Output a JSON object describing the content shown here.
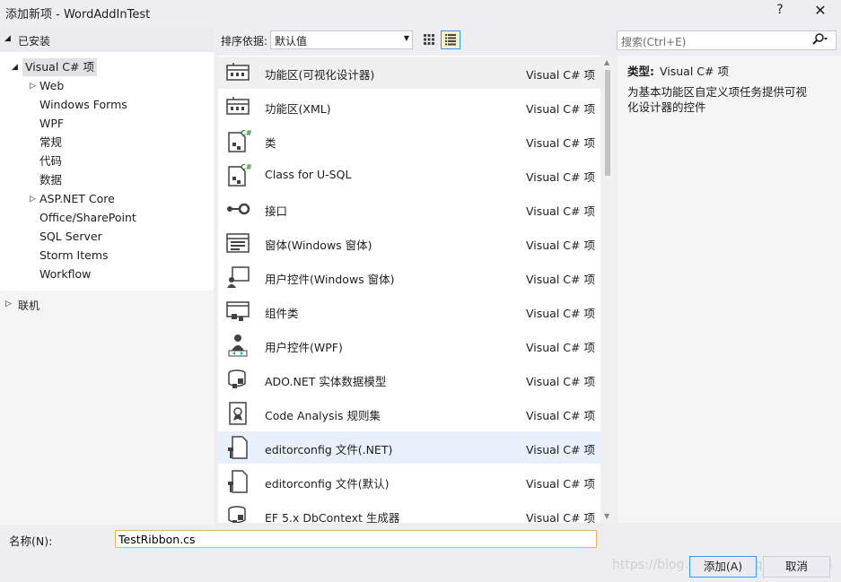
{
  "window": {
    "title": "添加新项 - WordAddInTest",
    "help_label": "?",
    "close_label": "✕"
  },
  "left_pane": {
    "installed_label": "已安装",
    "tree": [
      {
        "label": "Visual C# 项",
        "expand": "◢"
      },
      {
        "label": "Web",
        "expand": "▷"
      },
      {
        "label": "Windows Forms",
        "expand": ""
      },
      {
        "label": "WPF",
        "expand": ""
      },
      {
        "label": "常规",
        "expand": ""
      },
      {
        "label": "代码",
        "expand": ""
      },
      {
        "label": "数据",
        "expand": ""
      },
      {
        "label": "ASP.NET Core",
        "expand": "▷"
      },
      {
        "label": "Office/SharePoint",
        "expand": ""
      },
      {
        "label": "SQL Server",
        "expand": ""
      },
      {
        "label": "Storm Items",
        "expand": ""
      },
      {
        "label": "Workflow",
        "expand": ""
      }
    ],
    "online_label": "联机"
  },
  "toolbar": {
    "sort_label": "排序依据:",
    "sort_value": "默认值",
    "search_placeholder": "搜索(Ctrl+E)"
  },
  "items": [
    {
      "name": "功能区(可视化设计器)",
      "type": "Visual C# 项",
      "icon": "ribbon-icon"
    },
    {
      "name": "功能区(XML)",
      "type": "Visual C# 项",
      "icon": "ribbon-icon"
    },
    {
      "name": "类",
      "type": "Visual C# 项",
      "icon": "class-icon"
    },
    {
      "name": "Class for U-SQL",
      "type": "Visual C# 项",
      "icon": "class-icon"
    },
    {
      "name": "接口",
      "type": "Visual C# 项",
      "icon": "interface-icon"
    },
    {
      "name": "窗体(Windows 窗体)",
      "type": "Visual C# 项",
      "icon": "form-icon"
    },
    {
      "name": "用户控件(Windows 窗体)",
      "type": "Visual C# 项",
      "icon": "user-control-icon"
    },
    {
      "name": "组件类",
      "type": "Visual C# 项",
      "icon": "component-icon"
    },
    {
      "name": "用户控件(WPF)",
      "type": "Visual C# 项",
      "icon": "wpf-user-control-icon"
    },
    {
      "name": "ADO.NET 实体数据模型",
      "type": "Visual C# 项",
      "icon": "data-model-icon"
    },
    {
      "name": "Code Analysis 规则集",
      "type": "Visual C# 项",
      "icon": "ruleset-icon"
    },
    {
      "name": "editorconfig 文件(.NET)",
      "type": "Visual C# 项",
      "icon": "config-file-icon"
    },
    {
      "name": "editorconfig 文件(默认)",
      "type": "Visual C# 项",
      "icon": "config-file-icon"
    },
    {
      "name": "EF 5.x DbContext 生成器",
      "type": "Visual C# 项",
      "icon": "data-model-icon"
    }
  ],
  "detail": {
    "type_label": "类型:",
    "type_value": "Visual C# 项",
    "description": "为基本功能区自定义项任务提供可视化设计器的控件"
  },
  "bottom": {
    "name_label": "名称(N):",
    "name_value": "TestRibbon.cs",
    "add_label": "添加(A)",
    "cancel_label": "取消"
  },
  "watermark": "https://blog.csdn.net/qq_41780094",
  "colors": {
    "accent": "#3399ff",
    "selected_row": "#e8f0fb",
    "input_focus_border": "#e7b657"
  }
}
